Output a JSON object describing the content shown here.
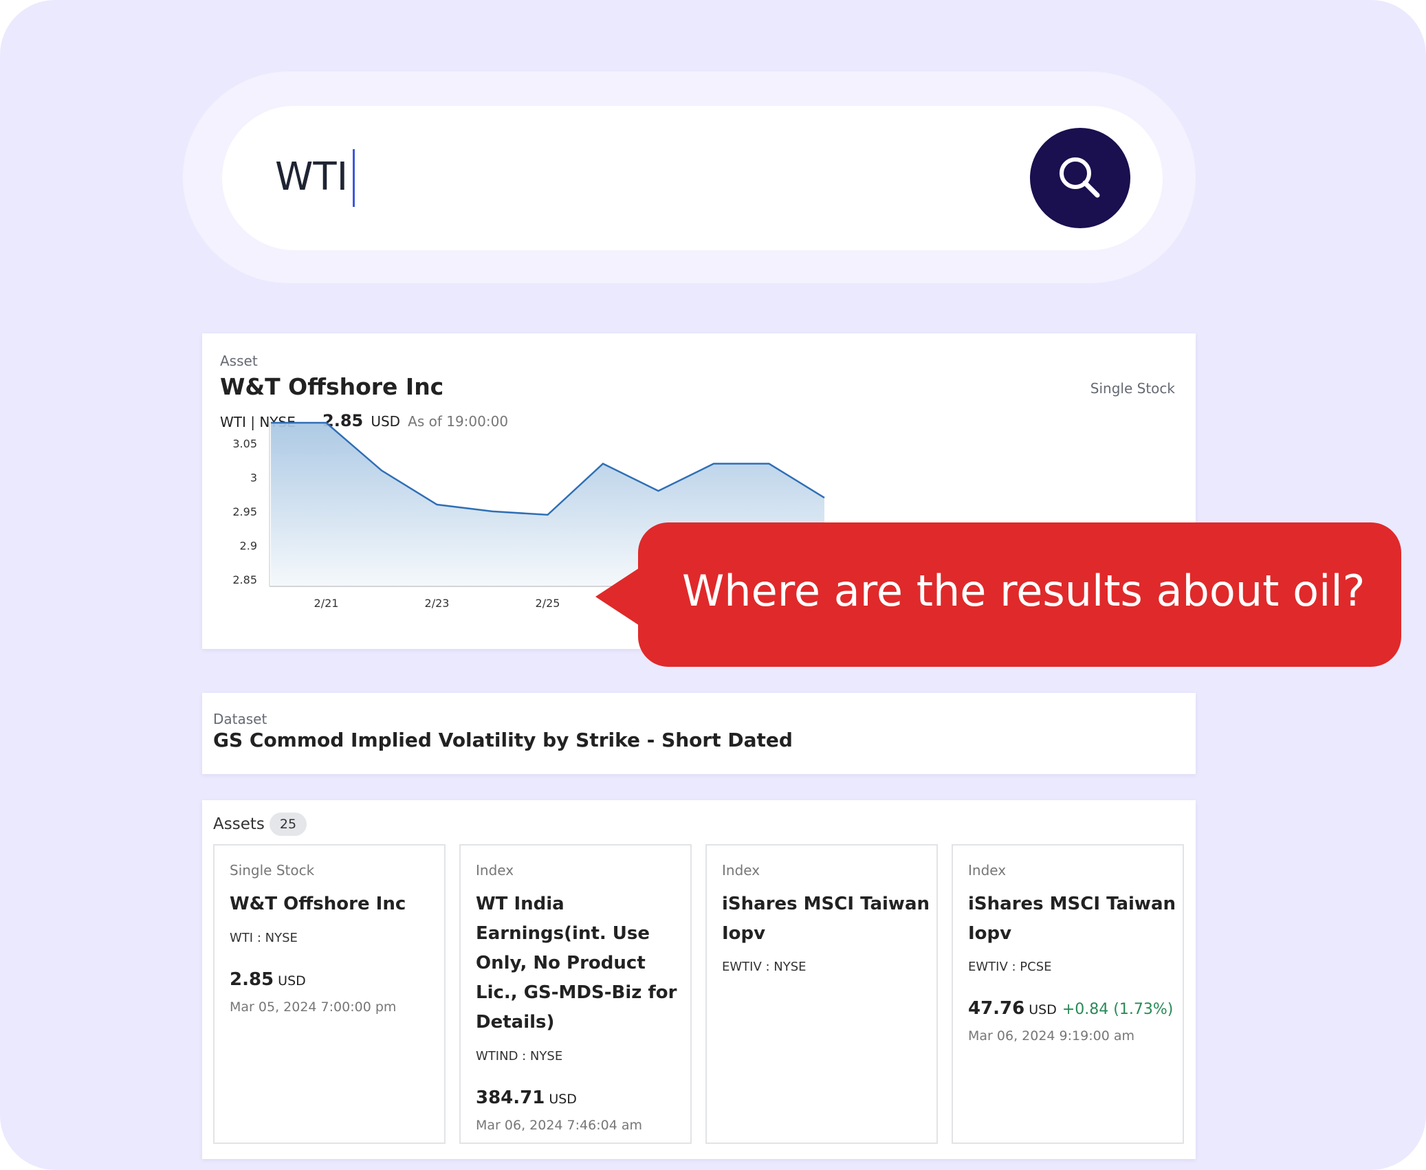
{
  "search": {
    "query": "WTI"
  },
  "asset_card": {
    "kind_label": "Asset",
    "name": "W&T Offshore Inc",
    "type": "Single Stock",
    "ticker": "WTI | NYSE",
    "price": "2.85",
    "currency": "USD",
    "as_of": "As of 19:00:00"
  },
  "chart_data": {
    "type": "area",
    "x_tick_labels": [
      "2/21",
      "2/23",
      "2/25"
    ],
    "y_tick_labels": [
      "3.05",
      "3",
      "2.95",
      "2.9",
      "2.85"
    ],
    "ylim": [
      2.84,
      3.08
    ],
    "x": [
      "2/20",
      "2/21",
      "2/22",
      "2/23",
      "2/24",
      "2/25",
      "2/26",
      "2/27",
      "2/28",
      "2/29",
      "3/1"
    ],
    "values": [
      3.08,
      3.08,
      3.01,
      2.96,
      2.95,
      2.945,
      3.02,
      2.98,
      3.02,
      3.02,
      2.97
    ],
    "grid": false,
    "line_color": "#2f6fb5",
    "fill_color": "#a9c7e3"
  },
  "callout": {
    "text": "Where are the results about oil?",
    "color": "#e0292a"
  },
  "dataset_card": {
    "kind_label": "Dataset",
    "name": "GS Commod Implied Volatility by Strike - Short Dated"
  },
  "assets_section": {
    "label": "Assets",
    "count": "25",
    "items": [
      {
        "type": "Single Stock",
        "name": "W&T Offshore Inc",
        "symbol": "WTI : NYSE",
        "price": "2.85",
        "currency": "USD",
        "change": "",
        "timestamp": "Mar 05, 2024 7:00:00 pm"
      },
      {
        "type": "Index",
        "name": "WT India Earnings(int. Use Only, No Product Lic., GS-MDS-Biz for Details)",
        "symbol": "WTIND : NYSE",
        "price": "384.71",
        "currency": "USD",
        "change": "",
        "timestamp": "Mar 06, 2024 7:46:04 am"
      },
      {
        "type": "Index",
        "name": "iShares MSCI Taiwan Iopv",
        "symbol": "EWTIV : NYSE",
        "price": "",
        "currency": "",
        "change": "",
        "timestamp": ""
      },
      {
        "type": "Index",
        "name": "iShares MSCI Taiwan Iopv",
        "symbol": "EWTIV : PCSE",
        "price": "47.76",
        "currency": "USD",
        "change": "+0.84 (1.73%)",
        "timestamp": "Mar 06, 2024 9:19:00 am"
      }
    ]
  },
  "colors": {
    "background": "#ebe9fe",
    "search_button": "#1a0f4f",
    "positive_change": "#2a8a57"
  },
  "icons": {
    "search_button": "search-icon"
  }
}
